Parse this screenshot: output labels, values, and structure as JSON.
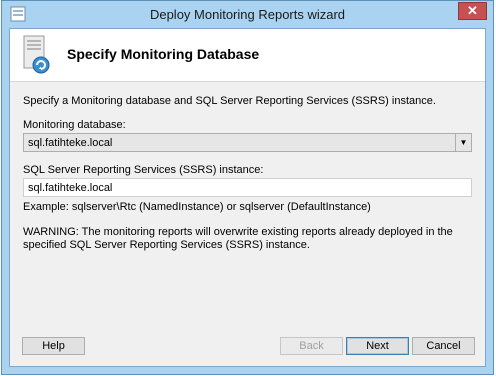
{
  "window": {
    "title": "Deploy Monitoring Reports wizard",
    "close_glyph": "✕"
  },
  "header": {
    "title": "Specify Monitoring Database",
    "icon": "server-deploy-icon"
  },
  "main": {
    "description": "Specify a Monitoring database and SQL Server Reporting Services (SSRS) instance.",
    "monitoring_db_label": "Monitoring database:",
    "monitoring_db_value": "sql.fatihteke.local",
    "ssrs_label": "SQL Server Reporting Services (SSRS) instance:",
    "ssrs_value": "sql.fatihteke.local",
    "example": "Example: sqlserver\\Rtc (NamedInstance) or sqlserver (DefaultInstance)",
    "warning": "WARNING: The monitoring reports will overwrite existing reports already deployed in the specified SQL Server Reporting Services (SSRS) instance."
  },
  "buttons": {
    "help": "Help",
    "back": "Back",
    "next": "Next",
    "cancel": "Cancel"
  },
  "colors": {
    "frame": "#a9d3f0",
    "close": "#c75050",
    "content_bg": "#f0f0f0"
  }
}
